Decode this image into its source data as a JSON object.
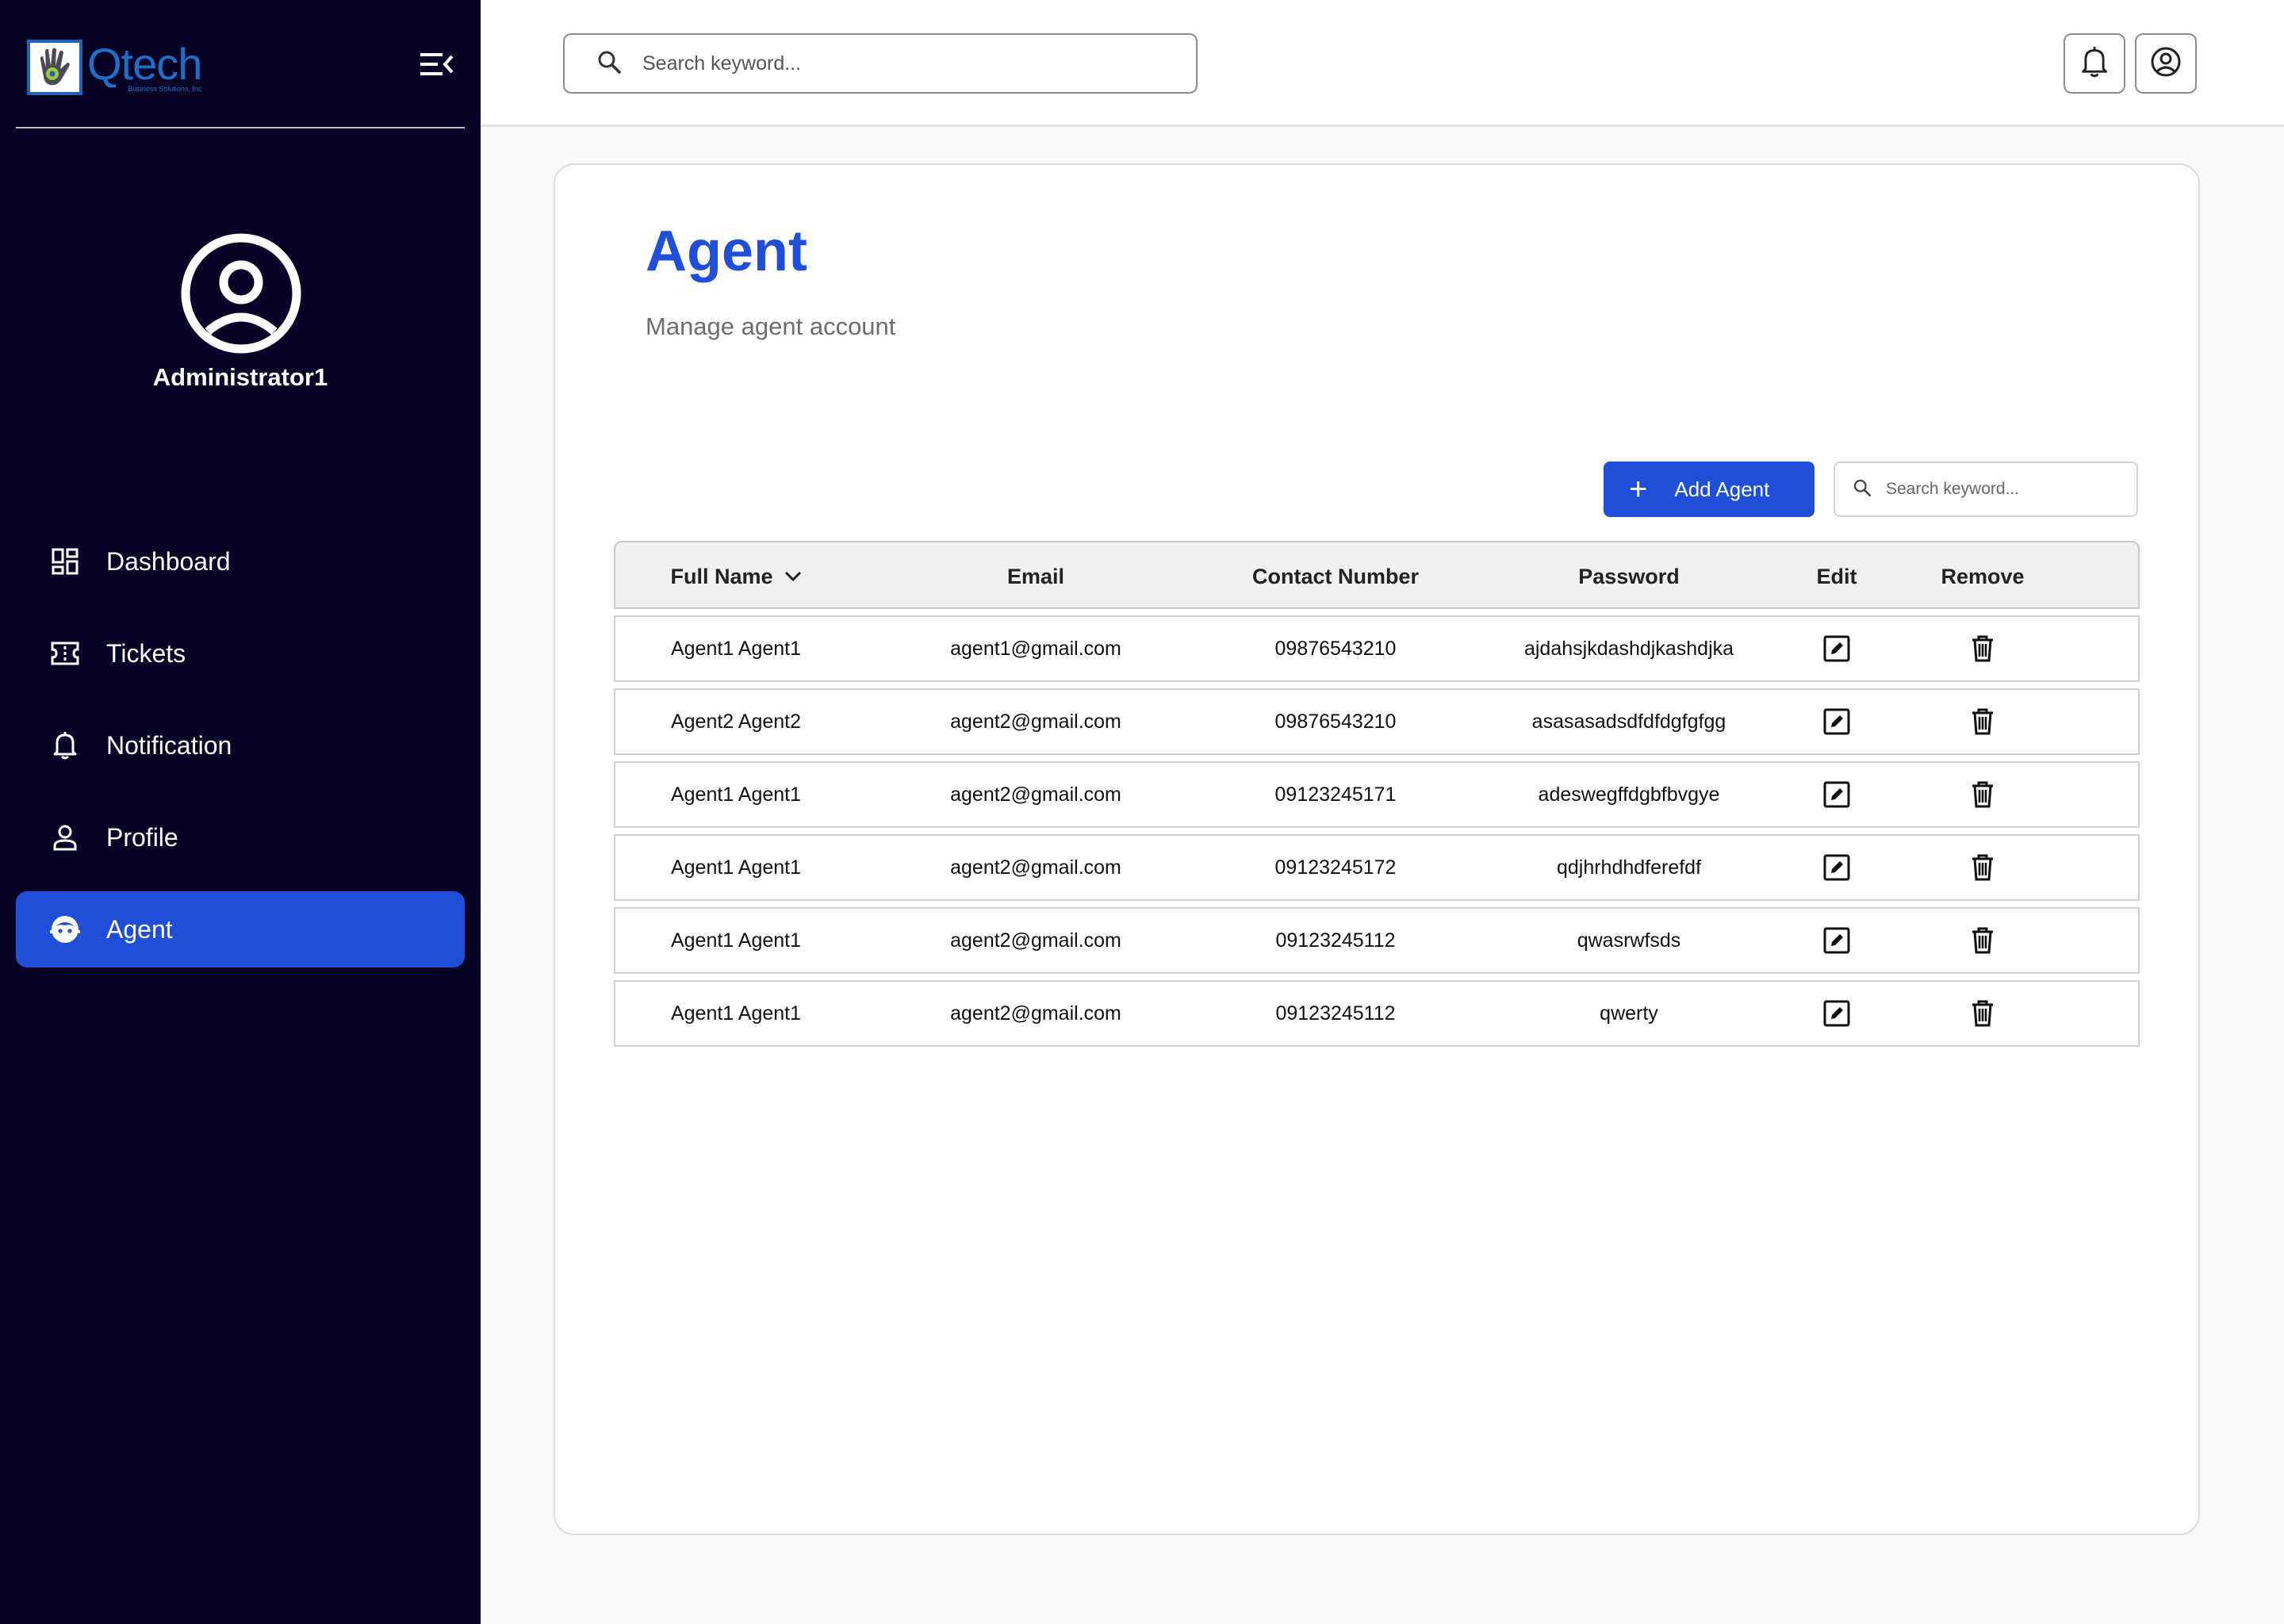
{
  "app": {
    "logo_text": "Qtech",
    "logo_subtext": "Business Solutions, Inc"
  },
  "sidebar": {
    "user_name": "Administrator1",
    "items": [
      {
        "label": "Dashboard",
        "icon": "dashboard-icon",
        "active": false
      },
      {
        "label": "Tickets",
        "icon": "ticket-icon",
        "active": false
      },
      {
        "label": "Notification",
        "icon": "bell-icon",
        "active": false
      },
      {
        "label": "Profile",
        "icon": "person-icon",
        "active": false
      },
      {
        "label": "Agent",
        "icon": "agent-icon",
        "active": true
      }
    ]
  },
  "topbar": {
    "search_placeholder": "Search keyword..."
  },
  "page": {
    "title": "Agent",
    "subtitle": "Manage agent account",
    "add_button_label": "Add Agent",
    "search_placeholder": "Search keyword..."
  },
  "table": {
    "columns": [
      "Full Name",
      "Email",
      "Contact Number",
      "Password",
      "Edit",
      "Remove"
    ],
    "rows": [
      {
        "name": "Agent1 Agent1",
        "email": "agent1@gmail.com",
        "contact": "09876543210",
        "password": "ajdahsjkdashdjkashdjka"
      },
      {
        "name": "Agent2 Agent2",
        "email": "agent2@gmail.com",
        "contact": "09876543210",
        "password": "asasasadsdfdfdgfgfgg"
      },
      {
        "name": "Agent1 Agent1",
        "email": "agent2@gmail.com",
        "contact": "09123245171",
        "password": "adeswegffdgbfbvgye"
      },
      {
        "name": "Agent1 Agent1",
        "email": "agent2@gmail.com",
        "contact": "09123245172",
        "password": "qdjhrhdhdferefdf"
      },
      {
        "name": "Agent1 Agent1",
        "email": "agent2@gmail.com",
        "contact": "09123245112",
        "password": "qwasrwfsds"
      },
      {
        "name": "Agent1 Agent1",
        "email": "agent2@gmail.com",
        "contact": "09123245112",
        "password": "qwerty"
      }
    ]
  },
  "colors": {
    "sidebar_bg": "#070327",
    "accent": "#1f4fd8",
    "brand": "#1f6fc8"
  }
}
